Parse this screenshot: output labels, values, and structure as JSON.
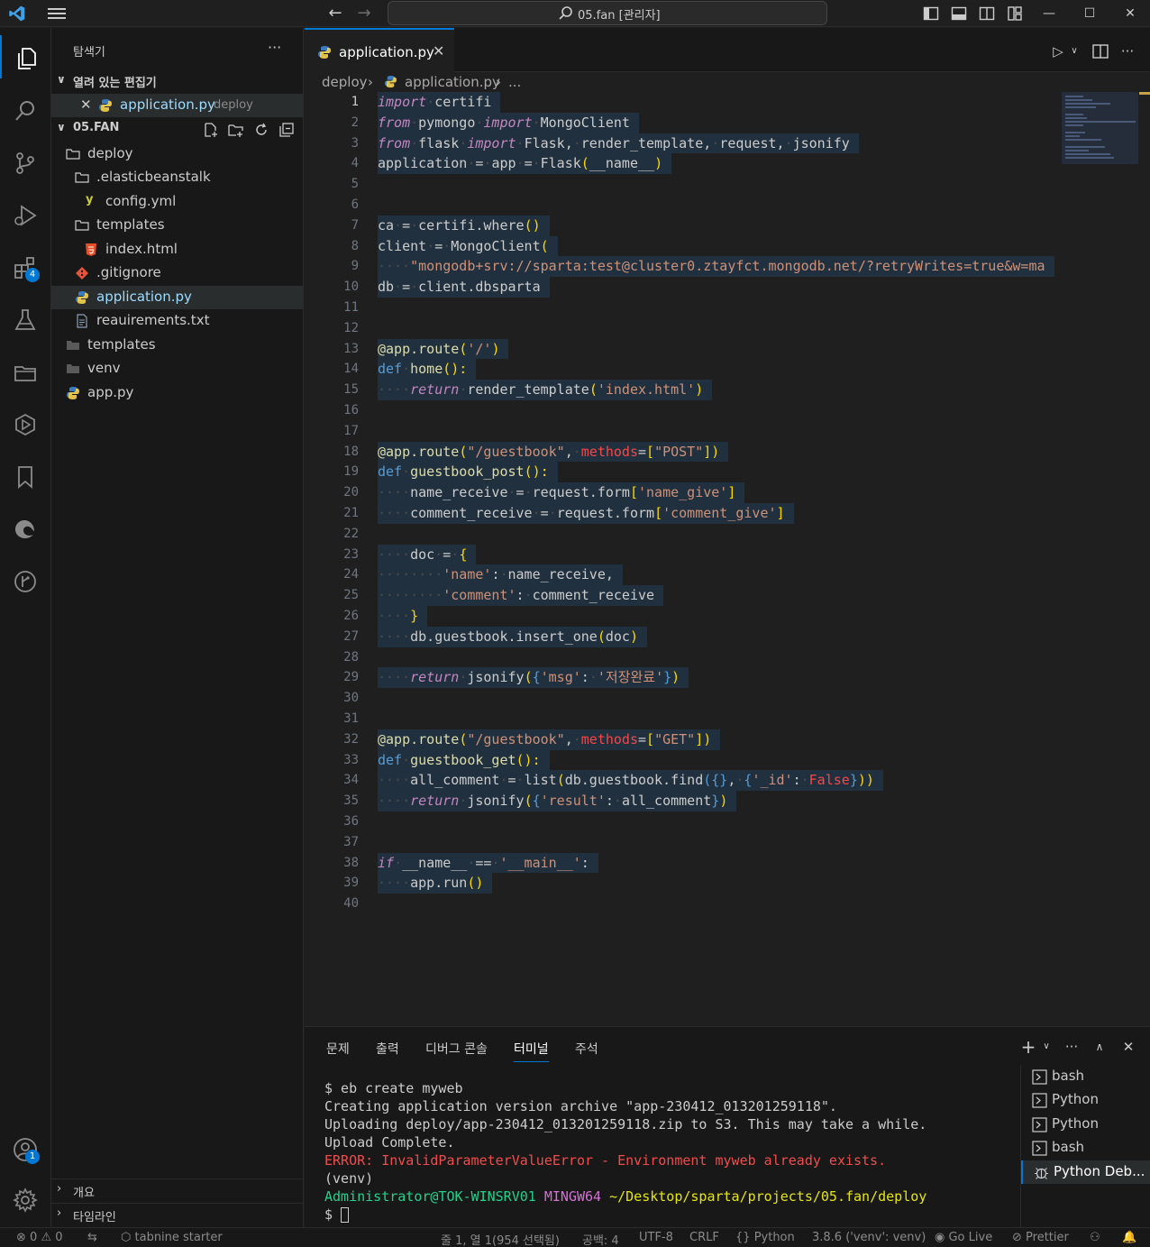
{
  "titlebar": {
    "search_text": "05.fan [관리자]"
  },
  "activity": {
    "extensions_badge": "4",
    "accounts_badge": "1"
  },
  "sidebar": {
    "title": "탐색기",
    "more": "···",
    "open_editors_label": "열려 있는 편집기",
    "open_editor_file": "application.py",
    "open_editor_desc": "deploy",
    "workspace_label": "05.FAN",
    "tree": [
      {
        "label": "deploy"
      },
      {
        "label": ".elasticbeanstalk"
      },
      {
        "label": "config.yml"
      },
      {
        "label": "templates"
      },
      {
        "label": "index.html"
      },
      {
        "label": ".gitignore"
      },
      {
        "label": "application.py"
      },
      {
        "label": "reauirements.txt"
      },
      {
        "label": "templates"
      },
      {
        "label": "venv"
      },
      {
        "label": "app.py"
      }
    ],
    "outline_label": "개요",
    "timeline_label": "타임라인"
  },
  "editor": {
    "tab_label": "application.py",
    "tab_close": "✕",
    "breadcrumb": [
      "deploy",
      "application.py",
      "..."
    ],
    "line_numbers": [
      "1",
      "2",
      "3",
      "4",
      "5",
      "6",
      "7",
      "8",
      "9",
      "10",
      "11",
      "12",
      "13",
      "14",
      "15",
      "16",
      "17",
      "18",
      "19",
      "20",
      "21",
      "22",
      "23",
      "24",
      "25",
      "26",
      "27",
      "28",
      "29",
      "30",
      "31",
      "32",
      "33",
      "34",
      "35",
      "36",
      "37",
      "38",
      "39",
      "40"
    ]
  },
  "panel": {
    "tabs": [
      "문제",
      "출력",
      "디버그 콘솔",
      "터미널",
      "주석"
    ],
    "active_tab": "터미널",
    "terminal": {
      "line1": "$ eb create myweb",
      "line2": "Creating application version archive \"app-230412_013201259118\".",
      "line3": "Uploading deploy/app-230412_013201259118.zip to S3. This may take a while.",
      "line4": "Upload Complete.",
      "line5": "ERROR: InvalidParameterValueError - Environment myweb already exists.",
      "line6": "(venv)",
      "prompt_user": "Administrator@TOK-WINSRV01",
      "prompt_env": "MINGW64",
      "prompt_path": "~/Desktop/sparta/projects/05.fan/deploy",
      "prompt": "$"
    },
    "terminals": [
      "bash",
      "Python",
      "Python",
      "bash",
      "Python Deb..."
    ]
  },
  "status": {
    "errors": "0",
    "warnings": "0",
    "tabnine": "tabnine starter",
    "position": "줄 1, 열 1(954 선택됨)",
    "spaces": "공백: 4",
    "encoding": "UTF-8",
    "eol": "CRLF",
    "language": "Python",
    "interpreter": "3.8.6 ('venv': venv)",
    "golive": "Go Live",
    "prettier": "Prettier"
  },
  "colors": {
    "accent": "#0078d4",
    "error": "#f14c4c",
    "prompt_green": "#23d18b",
    "prompt_magenta": "#d670d6",
    "prompt_yellow": "#e5e510"
  }
}
